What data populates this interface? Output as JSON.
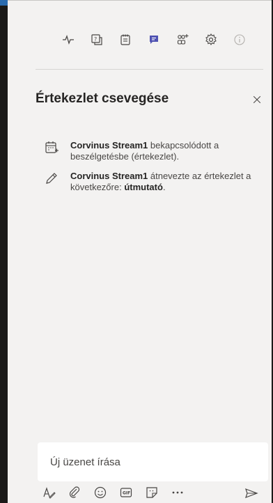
{
  "toolbar": {
    "icons": [
      "activity-icon",
      "qna-icon",
      "notes-icon",
      "chat-icon",
      "people-add-icon",
      "settings-icon",
      "info-icon"
    ],
    "accent": "#4f52b2"
  },
  "panel": {
    "title": "Értekezlet csevegése"
  },
  "events": [
    {
      "icon": "calendar-icon",
      "actor": "Corvinus Stream1",
      "text": " bekapcsolódott a beszélgetésbe (értekezlet)."
    },
    {
      "icon": "pencil-icon",
      "actor": "Corvinus Stream1",
      "text_before": " átnevezte az értekezlet a következőre: ",
      "new_name": "útmutató",
      "text_after": "."
    }
  ],
  "compose": {
    "placeholder": "Új üzenet írása"
  },
  "colors": {
    "background": "#f3f2f1",
    "compose_bg": "#ffffff",
    "text": "#252423",
    "muted": "#484644"
  }
}
